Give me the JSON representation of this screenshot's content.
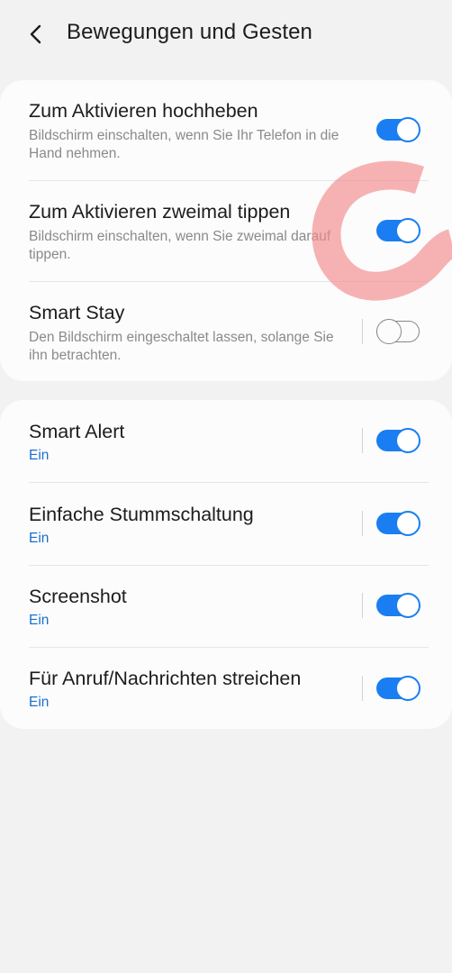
{
  "header": {
    "title": "Bewegungen und Gesten",
    "back_icon": "chevron-left-icon"
  },
  "colors": {
    "accent": "#1a7ef2",
    "status_text": "#1a6fd0",
    "annotation": "#f28b8b"
  },
  "card1": {
    "items": [
      {
        "title": "Zum Aktivieren hochheben",
        "subtitle": "Bildschirm einschalten, wenn Sie Ihr Telefon in die Hand nehmen.",
        "enabled": true
      },
      {
        "title": "Zum Aktivieren zweimal tippen",
        "subtitle": "Bildschirm einschalten, wenn Sie zweimal darauf tippen.",
        "enabled": true
      },
      {
        "title": "Smart Stay",
        "subtitle": "Den Bildschirm eingeschaltet lassen, solange Sie ihn betrachten.",
        "enabled": false
      }
    ]
  },
  "card2": {
    "items": [
      {
        "title": "Smart Alert",
        "status": "Ein",
        "enabled": true
      },
      {
        "title": "Einfache Stummschaltung",
        "status": "Ein",
        "enabled": true
      },
      {
        "title": "Screenshot",
        "status": "Ein",
        "enabled": true
      },
      {
        "title": "Für Anruf/Nachrichten streichen",
        "status": "Ein",
        "enabled": true
      }
    ]
  }
}
